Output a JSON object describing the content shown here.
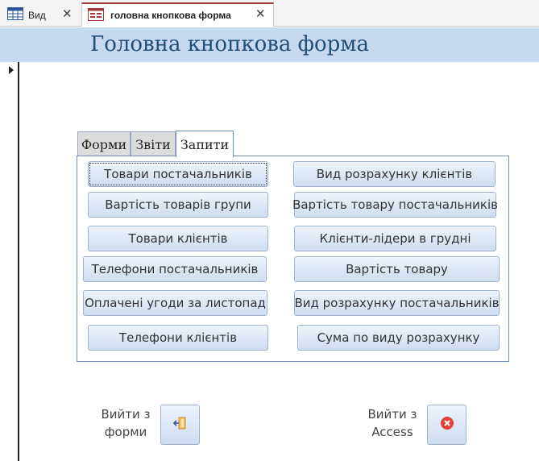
{
  "document_tabs": [
    {
      "label": "Вид",
      "icon": "datasheet-icon",
      "active": false
    },
    {
      "label": "головна кнопкова форма",
      "icon": "form-icon",
      "active": true
    }
  ],
  "form": {
    "title": "Головна кнопкова форма",
    "header_color": "#c6d9f0",
    "title_color": "#1f4e79"
  },
  "tab_control": {
    "tabs": [
      "Форми",
      "Звіти",
      "Запити"
    ],
    "selected": "Запити"
  },
  "queries": {
    "left_column": [
      "Товари постачальників",
      "Вартість товарів групи",
      "Товари клієнтів",
      "Телефони постачальників",
      "Оплачені угоди за листопад",
      "Телефони клієнтів"
    ],
    "right_column": [
      "Вид розрахунку клієнтів",
      "Вартість товару постачальників",
      "Клієнти-лідери в грудні",
      "Вартість товару",
      "Вид розрахунку постачальників",
      "Сума по виду розрахунку"
    ],
    "focused": "Товари постачальників"
  },
  "exit_form": {
    "label_line1": "Вийти з",
    "label_line2": "форми",
    "icon": "exit-door-icon"
  },
  "exit_access": {
    "label_line1": "Вийти з",
    "label_line2": "Access",
    "icon": "close-circle-icon",
    "icon_color": "#e0433a"
  }
}
